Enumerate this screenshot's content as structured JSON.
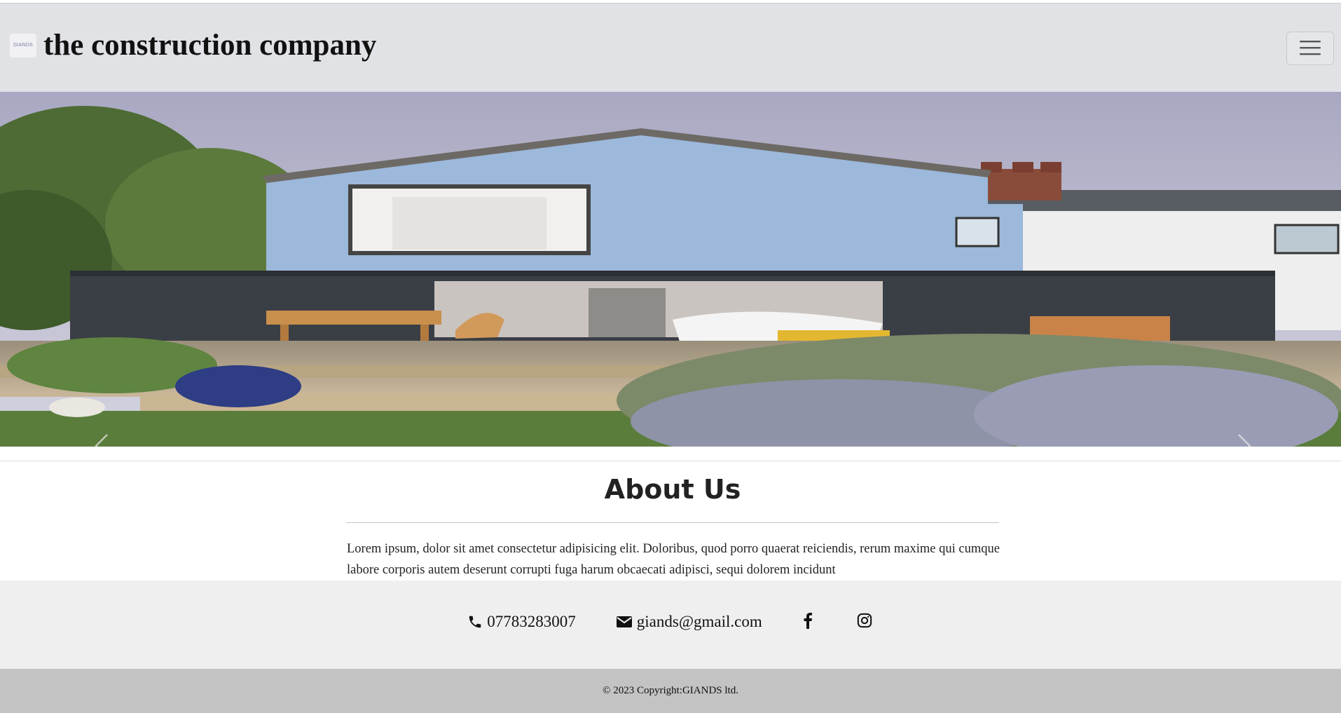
{
  "navbar": {
    "logo_text": "GIANDS",
    "brand_name": "the construction company",
    "toggler_icon": "hamburger-menu-icon"
  },
  "hero": {
    "prev_icon": "chevron-left-icon",
    "next_icon": "chevron-right-icon"
  },
  "about": {
    "title": "About Us",
    "text": "Lorem ipsum, dolor sit amet consectetur adipisicing elit. Doloribus, quod porro quaerat reiciendis, rerum maxime qui cumque labore corporis autem deserunt corrupti fuga harum obcaecati adipisci, sequi dolorem incidunt"
  },
  "contact": {
    "phone": "07783283007",
    "email": "giands@gmail.com",
    "phone_icon": "phone-icon",
    "email_icon": "envelope-icon",
    "facebook_icon": "facebook-icon",
    "instagram_icon": "instagram-icon"
  },
  "footer": {
    "copyright": "© 2023 Copyright:GIANDS ltd."
  },
  "colors": {
    "navbar_bg": "#e0e2e6",
    "contact_bg": "#efefef",
    "footer_bg": "#c3c3c3"
  }
}
